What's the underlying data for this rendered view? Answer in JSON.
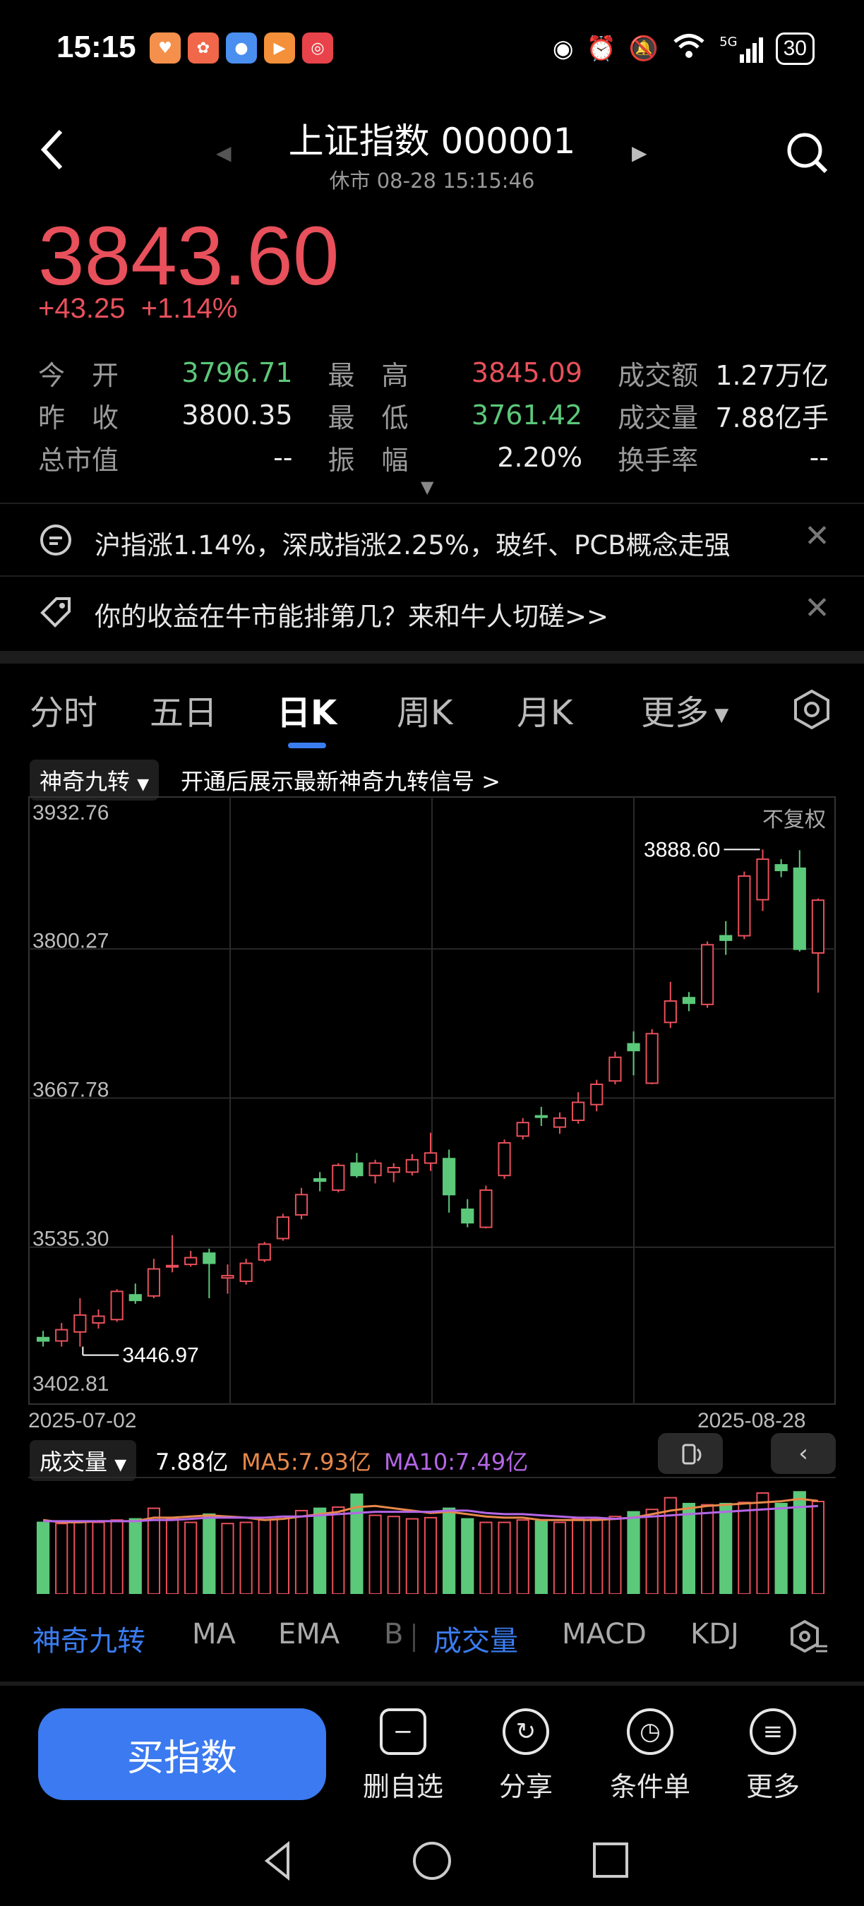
{
  "status": {
    "time": "15:15",
    "battery": "30",
    "network": "5G"
  },
  "header": {
    "title": "上证指数 000001",
    "subtitle": "休市 08-28 15:15:46"
  },
  "quote": {
    "price": "3843.60",
    "change": "+43.25",
    "change_pct": "+1.14%"
  },
  "stats": [
    [
      {
        "label": "今　开",
        "value": "3796.71",
        "color": "green"
      },
      {
        "label": "最　高",
        "value": "3845.09",
        "color": "red"
      },
      {
        "label": "成交额",
        "value": "1.27万亿",
        "color": "white"
      }
    ],
    [
      {
        "label": "昨　收",
        "value": "3800.35",
        "color": "white"
      },
      {
        "label": "最　低",
        "value": "3761.42",
        "color": "green"
      },
      {
        "label": "成交量",
        "value": "7.88亿手",
        "color": "white"
      }
    ],
    [
      {
        "label": "总市值",
        "value": "--",
        "color": "white"
      },
      {
        "label": "振　幅",
        "value": "2.20%",
        "color": "white"
      },
      {
        "label": "换手率",
        "value": "--",
        "color": "white"
      }
    ]
  ],
  "notices": [
    {
      "text": "沪指涨1.14%，深成指涨2.25%，玻纤、PCB概念走强",
      "icon": "chat-icon"
    },
    {
      "text": "你的收益在牛市能排第几？来和牛人切磋>>",
      "icon": "tag-icon"
    }
  ],
  "tabs": [
    "分时",
    "五日",
    "日K",
    "周K",
    "月K",
    "更多"
  ],
  "active_tab": "日K",
  "indicator": {
    "selector": "神奇九转",
    "promo": "开通后展示最新神奇九转信号 >",
    "adjust": "不复权"
  },
  "volume_header": {
    "selector": "成交量",
    "volume": "7.88亿",
    "ma5": "MA5:7.93亿",
    "ma10": "MA10:7.49亿"
  },
  "chart_data": {
    "type": "candlestick",
    "y_ticks": [
      "3932.76",
      "3800.27",
      "3667.78",
      "3535.30",
      "3402.81"
    ],
    "ylim": [
      3402.81,
      3932.76
    ],
    "x_start": "2025-07-02",
    "x_end": "2025-08-28",
    "high_label": "3888.60",
    "low_label": "3446.97",
    "candles": [
      [
        3455,
        3452,
        3461,
        3447
      ],
      [
        3452,
        3462,
        3468,
        3447
      ],
      [
        3460,
        3475,
        3490,
        3446.97
      ],
      [
        3468,
        3474,
        3480,
        3463
      ],
      [
        3471,
        3496,
        3498,
        3469
      ],
      [
        3493,
        3488,
        3503,
        3485
      ],
      [
        3492,
        3516,
        3525,
        3490
      ],
      [
        3518,
        3519,
        3546,
        3513
      ],
      [
        3520,
        3526,
        3532,
        3518
      ],
      [
        3530,
        3521,
        3534,
        3490
      ],
      [
        3508,
        3510,
        3520,
        3494
      ],
      [
        3505,
        3521,
        3525,
        3502
      ],
      [
        3524,
        3538,
        3540,
        3522
      ],
      [
        3543,
        3562,
        3565,
        3541
      ],
      [
        3564,
        3582,
        3588,
        3560
      ],
      [
        3596,
        3594,
        3602,
        3585
      ],
      [
        3586,
        3608,
        3610,
        3584
      ],
      [
        3610,
        3599,
        3619,
        3597
      ],
      [
        3599,
        3610,
        3613,
        3592
      ],
      [
        3602,
        3606,
        3610,
        3593
      ],
      [
        3602,
        3613,
        3618,
        3599
      ],
      [
        3610,
        3619,
        3637,
        3603
      ],
      [
        3614,
        3582,
        3622,
        3566
      ],
      [
        3569,
        3557,
        3578,
        3553
      ],
      [
        3553,
        3586,
        3590,
        3552
      ],
      [
        3599,
        3628,
        3631,
        3596
      ],
      [
        3634,
        3646,
        3650,
        3631
      ],
      [
        3652,
        3651,
        3660,
        3643
      ],
      [
        3642,
        3650,
        3655,
        3636
      ],
      [
        3648,
        3664,
        3673,
        3645
      ],
      [
        3662,
        3680,
        3684,
        3656
      ],
      [
        3683,
        3704,
        3709,
        3680
      ],
      [
        3716,
        3710,
        3727,
        3688
      ],
      [
        3681,
        3725,
        3729,
        3680
      ],
      [
        3735,
        3754,
        3771,
        3730
      ],
      [
        3757,
        3752,
        3762,
        3745
      ],
      [
        3751,
        3804,
        3807,
        3748
      ],
      [
        3812,
        3808,
        3825,
        3795
      ],
      [
        3812,
        3865,
        3869,
        3809
      ],
      [
        3844,
        3880,
        3888.6,
        3834
      ],
      [
        3875,
        3870,
        3880,
        3864
      ],
      [
        3872,
        3800,
        3888,
        3798
      ],
      [
        3796.71,
        3843.6,
        3845.09,
        3761.42
      ]
    ],
    "volumes": [
      6.1,
      6.0,
      6.2,
      6.1,
      6.3,
      6.4,
      7.3,
      6.4,
      6.1,
      6.8,
      6.0,
      6.1,
      6.3,
      6.6,
      7.1,
      7.3,
      7.4,
      8.5,
      6.7,
      6.6,
      6.4,
      6.5,
      7.3,
      6.4,
      6.1,
      6.1,
      6.3,
      6.2,
      6.1,
      6.4,
      6.4,
      6.6,
      7.0,
      7.2,
      8.2,
      7.7,
      7.6,
      7.7,
      7.8,
      8.6,
      7.7,
      8.7,
      7.88
    ],
    "ma5": [
      6.3,
      6.1,
      6.1,
      6.2,
      6.2,
      6.2,
      6.5,
      6.5,
      6.6,
      6.7,
      6.6,
      6.5,
      6.3,
      6.4,
      6.6,
      6.8,
      7.0,
      7.4,
      7.5,
      7.3,
      7.1,
      6.9,
      7.0,
      6.8,
      6.6,
      6.5,
      6.5,
      6.3,
      6.3,
      6.3,
      6.3,
      6.4,
      6.5,
      6.8,
      7.1,
      7.3,
      7.5,
      7.6,
      7.7,
      7.8,
      7.9,
      8.1,
      7.93
    ],
    "ma10": [
      6.2,
      6.2,
      6.2,
      6.2,
      6.2,
      6.2,
      6.3,
      6.3,
      6.4,
      6.5,
      6.5,
      6.5,
      6.5,
      6.6,
      6.6,
      6.7,
      6.8,
      6.9,
      7.0,
      7.0,
      7.0,
      7.0,
      7.1,
      7.1,
      6.9,
      6.8,
      6.8,
      6.7,
      6.6,
      6.5,
      6.5,
      6.4,
      6.5,
      6.6,
      6.7,
      6.8,
      6.9,
      7.0,
      7.1,
      7.2,
      7.3,
      7.4,
      7.49
    ]
  },
  "bottom_tabs": [
    "神奇九转",
    "MA",
    "EMA",
    "B",
    "成交量",
    "MACD",
    "KDJ"
  ],
  "buy_label": "买指数",
  "actions": [
    {
      "label": "删自选",
      "icon": "minus-square-icon"
    },
    {
      "label": "分享",
      "icon": "share-icon"
    },
    {
      "label": "条件单",
      "icon": "clock-icon"
    },
    {
      "label": "更多",
      "icon": "menu-icon"
    }
  ],
  "colors": {
    "up": "#e8505b",
    "down": "#5cc87a",
    "accent": "#3a7df0",
    "ma5": "#e8884a",
    "ma10": "#b467e6"
  }
}
